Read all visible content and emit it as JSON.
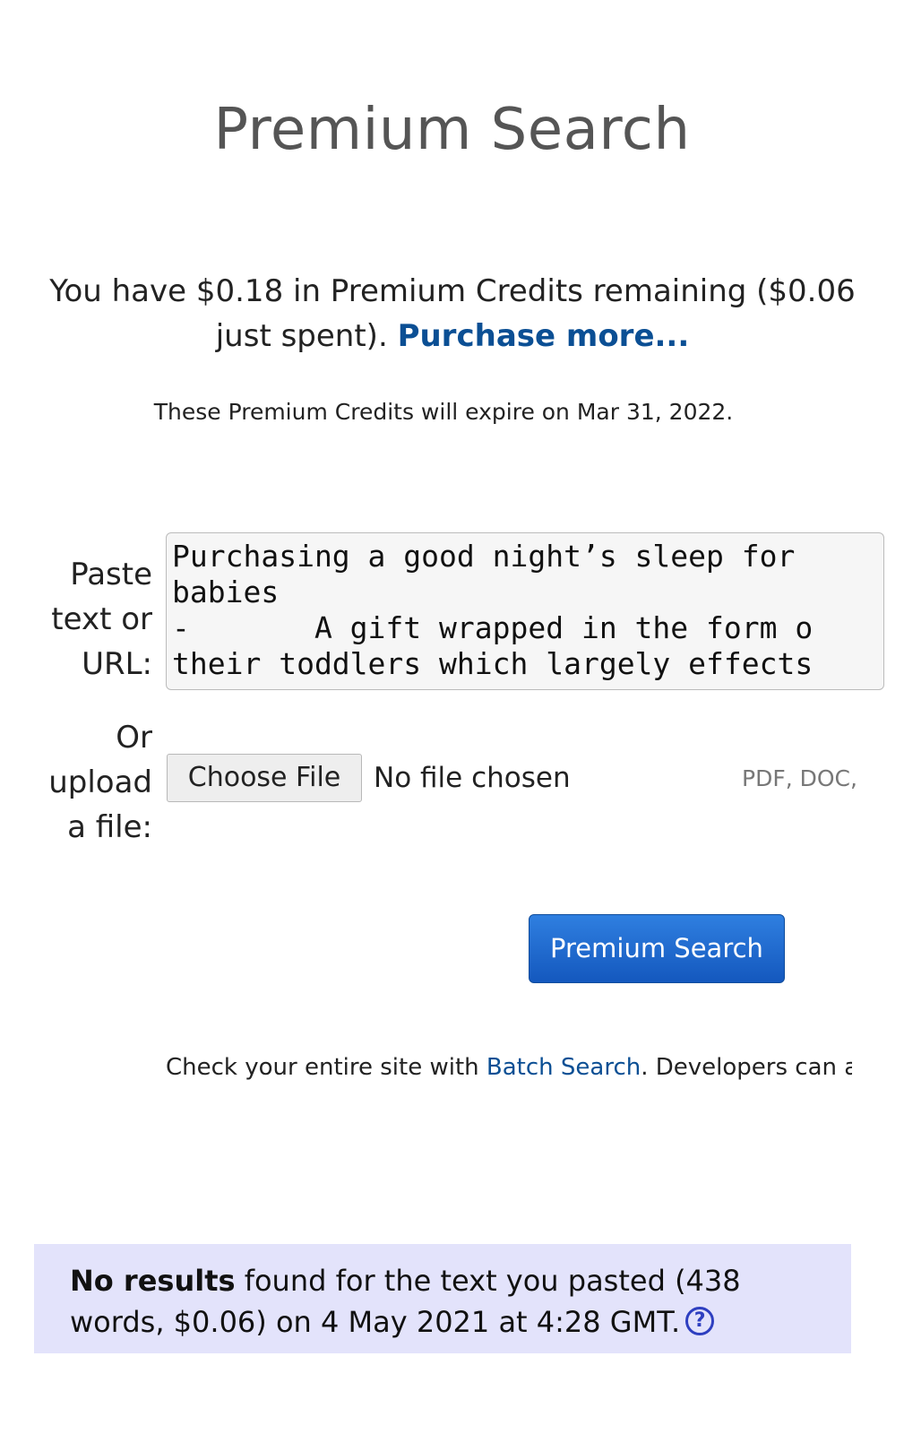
{
  "header": {
    "title": "Premium Search"
  },
  "credits": {
    "text": "You have $0.18 in Premium Credits remaining ($0.06 just spent).",
    "purchase_link": "Purchase more...",
    "expire_text": "These Premium Credits will expire on Mar 31, 2022."
  },
  "paste": {
    "label": "Paste text or URL:",
    "value": "Purchasing a good night’s sleep for\nbabies\n-       A gift wrapped in the form o\ntheir toddlers which largely effects"
  },
  "upload": {
    "label": "Or upload a file:",
    "button_label": "Choose File",
    "status": "No file chosen",
    "file_types": "PDF, DOC,"
  },
  "search_button": {
    "label": "Premium Search"
  },
  "batch": {
    "prefix": "Check your entire site with ",
    "link": "Batch Search",
    "suffix": ". Developers can als"
  },
  "results": {
    "bold": "No results",
    "text": " found for the text you pasted (438 words, $0.06) on 4 May 2021 at 4:28 GMT.",
    "help_icon": "question-circle-icon",
    "help_glyph": "?"
  },
  "colors": {
    "link": "#0b4f94",
    "button": "#1a66cc",
    "results_bg": "#e3e3fb"
  }
}
